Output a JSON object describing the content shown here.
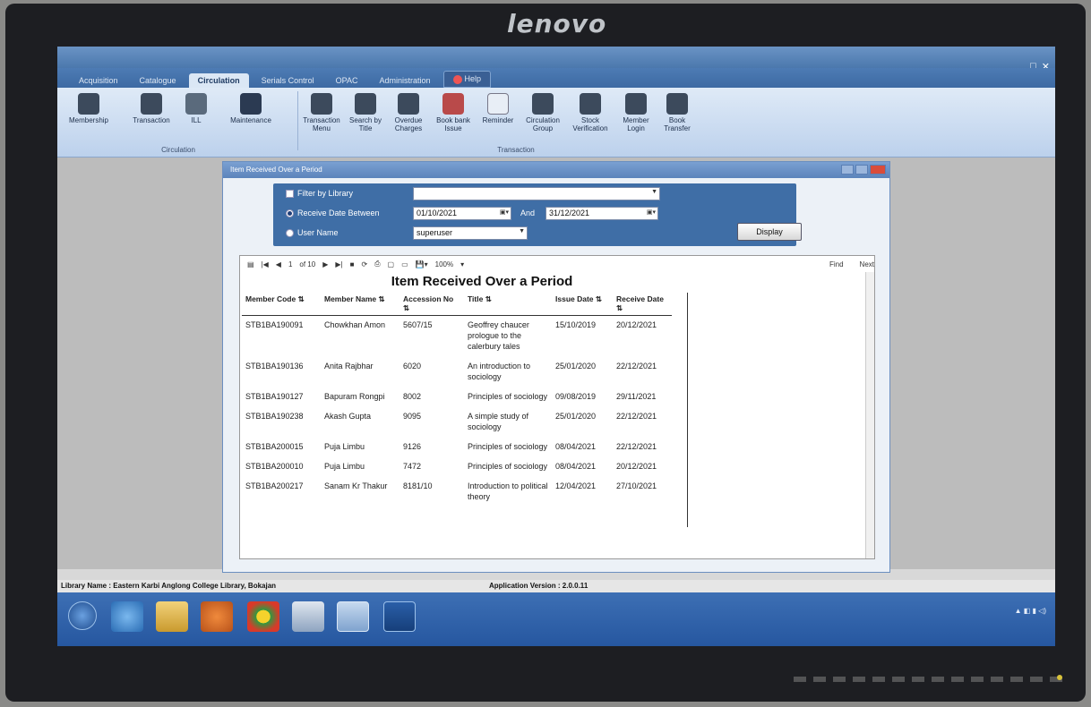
{
  "brand": "lenovo",
  "ribbon_tabs": [
    "Acquisition",
    "Catalogue",
    "Circulation",
    "Serials Control",
    "OPAC",
    "Administration",
    "Help"
  ],
  "active_tab": "Circulation",
  "ribbon": {
    "circulation_group": {
      "label": "Circulation",
      "buttons": [
        "Membership",
        "Transaction",
        "ILL",
        "Maintenance"
      ]
    },
    "transaction_group": {
      "label": "Transaction",
      "buttons": [
        "Transaction Menu",
        "Search by Title",
        "Overdue Charges",
        "Book bank Issue",
        "Reminder",
        "Circulation Group",
        "Stock Verification",
        "Member Login",
        "Book Transfer"
      ]
    }
  },
  "dialog": {
    "title": "Item Received Over a Period",
    "filter_by_library_label": "Filter by Library",
    "library_value": "",
    "receive_date_label": "Receive Date Between",
    "date_from": "01/10/2021",
    "and_label": "And",
    "date_to": "31/12/2021",
    "user_name_label": "User Name",
    "user_name_value": "superuser",
    "display_button": "Display"
  },
  "report": {
    "toolbar": {
      "page": "1",
      "page_of": "of 10",
      "zoom": "100%",
      "find": "Find",
      "next": "Next"
    },
    "title": "Item Received Over a Period",
    "columns": [
      "Member Code",
      "Member Name",
      "Accession No",
      "Title",
      "Issue Date",
      "Receive Date"
    ],
    "rows": [
      [
        "STB1BA190091",
        "Chowkhan Amon",
        "5607/15",
        "Geoffrey chaucer prologue to the calerbury tales",
        "15/10/2019",
        "20/12/2021"
      ],
      [
        "STB1BA190136",
        "Anita Rajbhar",
        "6020",
        "An introduction to sociology",
        "25/01/2020",
        "22/12/2021"
      ],
      [
        "STB1BA190127",
        "Bapuram Rongpi",
        "8002",
        "Principles of sociology",
        "09/08/2019",
        "29/11/2021"
      ],
      [
        "STB1BA190238",
        "Akash Gupta",
        "9095",
        "A simple study of sociology",
        "25/01/2020",
        "22/12/2021"
      ],
      [
        "STB1BA200015",
        "Puja Limbu",
        "9126",
        "Principles of sociology",
        "08/04/2021",
        "22/12/2021"
      ],
      [
        "STB1BA200010",
        "Puja Limbu",
        "7472",
        "Principles of sociology",
        "08/04/2021",
        "20/12/2021"
      ],
      [
        "STB1BA200217",
        "Sanam Kr Thakur",
        "8181/10",
        "Introduction to political theory",
        "12/04/2021",
        "27/10/2021"
      ]
    ]
  },
  "status": {
    "library": "Library Name : Eastern Karbi Anglong College Library, Bokajan",
    "version": "Application Version : 2.0.0.11"
  }
}
